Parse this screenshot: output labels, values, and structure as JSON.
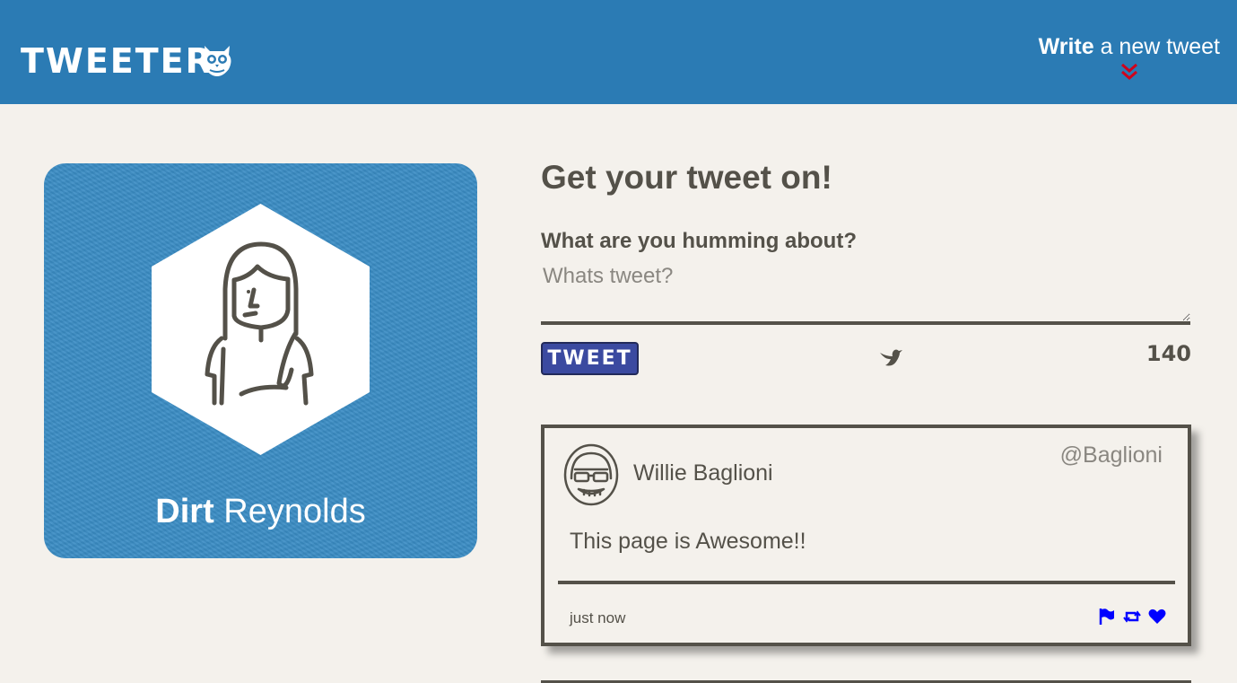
{
  "nav": {
    "logo": "TWEETER",
    "compose_bold": "Write",
    "compose_rest": " a new tweet"
  },
  "profile": {
    "first_name": "Dirt",
    "last_name": " Reynolds"
  },
  "compose": {
    "title": "Get your tweet on!",
    "label": "What are you humming about?",
    "placeholder": "Whats tweet?",
    "button": "TWEET",
    "counter": "140"
  },
  "tweets": [
    {
      "name": "Willie Baglioni",
      "handle": "@Baglioni",
      "text": "This page is Awesome!!",
      "time": "just now"
    }
  ],
  "colors": {
    "nav": "#2b7bb4",
    "background": "#f4f1ec",
    "text": "#545149",
    "button": "#3b4aa0",
    "chevron": "#d0021b",
    "actions": "#0000ff"
  },
  "icons": [
    "owl-icon",
    "chevron-down-icon",
    "avatar-icon",
    "bird-icon",
    "flag-icon",
    "retweet-icon",
    "heart-icon"
  ]
}
